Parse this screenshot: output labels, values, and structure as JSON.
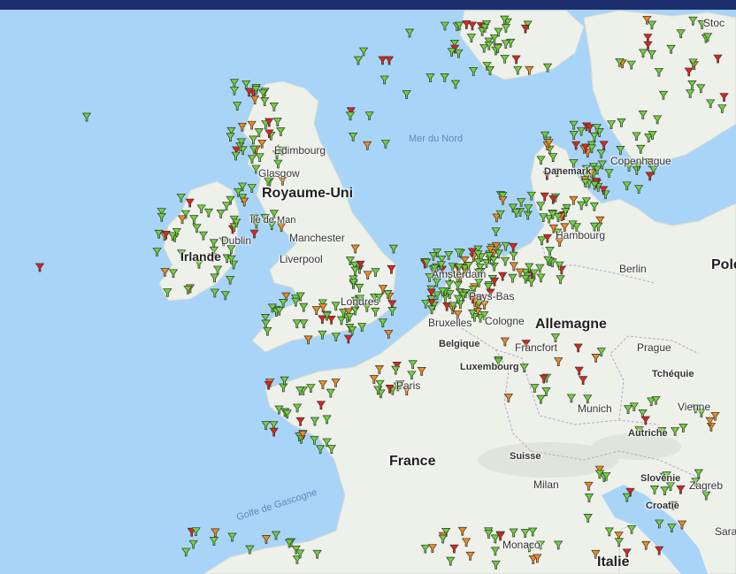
{
  "labels": {
    "royaume_uni": "Royaume-Uni",
    "irlande": "Irlande",
    "france": "France",
    "allemagne": "Allemagne",
    "italie": "Italie",
    "pologne": "Pole",
    "belgique": "Belgique",
    "tcheque": "Tchéquie",
    "autriche": "Autriche",
    "suisse": "Suisse",
    "croatie": "Croatie",
    "slovenie": "Slovénie",
    "luxembourg": "Luxembourg",
    "danemark": "Danemark",
    "mer_du_nord": "Mer du Nord",
    "golfe": "Golfe de Gascogne",
    "edimbourg": "Édimbourg",
    "glasgow": "Glasgow",
    "ile_de_man": "Île de Man",
    "dublin": "Dublin",
    "manchester": "Manchester",
    "liverpool": "Liverpool",
    "londres": "Londres",
    "amsterdam": "Amsterdam",
    "pays_bas": "Pays-Bas",
    "bruxelles": "Bruxelles",
    "cologne": "Cologne",
    "francfort": "Francfort",
    "paris": "Paris",
    "munich": "Munich",
    "prague": "Prague",
    "vienne": "Vienne",
    "zagreb": "Zagreb",
    "milan": "Milan",
    "monaco": "Monaco",
    "berlin": "Berlin",
    "hambourg": "Hambourg",
    "copenhague": "Copenhague",
    "stockholm": "Stoc",
    "sarajevo": "Sara"
  },
  "marker_colors": {
    "green": "#6ed33a",
    "orange": "#f08a1c",
    "red": "#e0231b"
  },
  "colors": {
    "sea": "#a8d4f7",
    "land": "#eef0ea",
    "border": "#b9a8c9",
    "topbar": "#1d2f6e"
  }
}
